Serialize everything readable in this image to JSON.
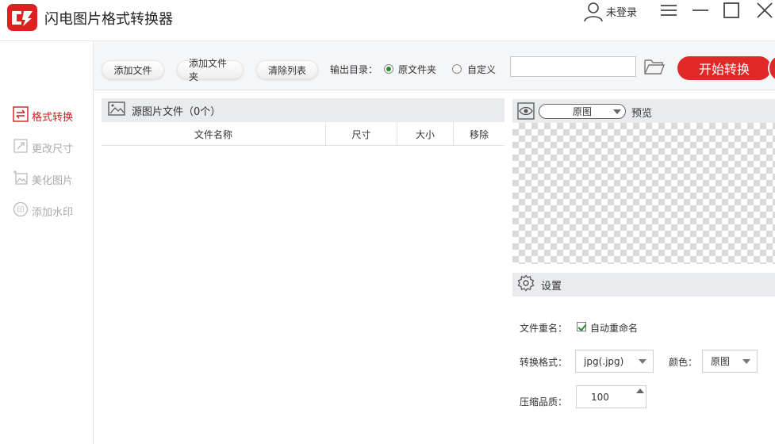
{
  "app": {
    "title": "闪电图片格式转换器"
  },
  "user": {
    "label": "未登录"
  },
  "sidebar": {
    "items": [
      {
        "label": "格式转换",
        "active": true
      },
      {
        "label": "更改尺寸",
        "active": false
      },
      {
        "label": "美化图片",
        "active": false
      },
      {
        "label": "添加水印",
        "active": false
      }
    ]
  },
  "toolbar": {
    "add_file": "添加文件",
    "add_folder": "添加文件夹",
    "clear_list": "清除列表",
    "output_dir_label": "输出目录：",
    "radio_original": "原文件夹",
    "radio_custom": "自定义",
    "output_path": "",
    "start": "开始转换"
  },
  "file_panel": {
    "title": "源图片文件（0个）",
    "columns": [
      "文件名称",
      "尺寸",
      "大小",
      "移除"
    ],
    "rows": []
  },
  "preview": {
    "mode": "原图",
    "label": "预览"
  },
  "settings": {
    "title": "设置",
    "rename_label": "文件重名：",
    "auto_rename": "自动重命名",
    "auto_rename_checked": true,
    "format_label": "转换格式：",
    "format_value": "jpg(.jpg)",
    "color_label": "颜色：",
    "color_value": "原图",
    "quality_label": "压缩品质：",
    "quality_value": "100"
  },
  "colors": {
    "accent": "#e02828",
    "active_text": "#c62222",
    "check_green": "#2e8b2e"
  }
}
